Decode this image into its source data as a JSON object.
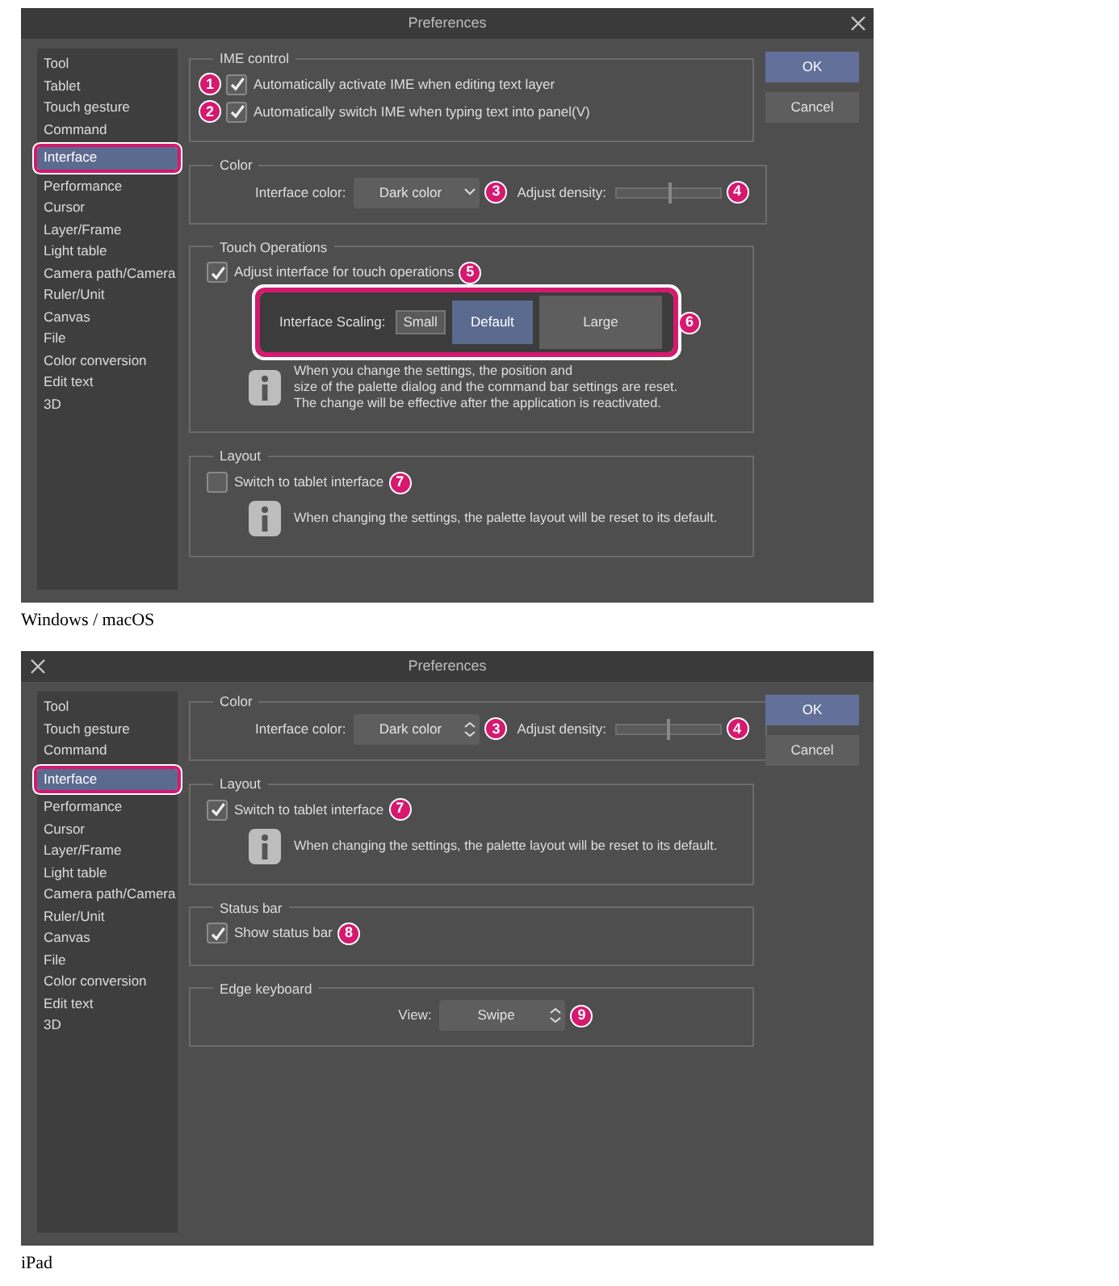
{
  "figures": [
    {
      "caption": "Windows / macOS",
      "dialog": {
        "title": "Preferences",
        "kind": "desktop",
        "sidebar": [
          {
            "label": "Tool",
            "selected": false
          },
          {
            "label": "Tablet",
            "selected": false
          },
          {
            "label": "Touch gesture",
            "selected": false
          },
          {
            "label": "Command",
            "selected": false
          },
          {
            "label": "Interface",
            "selected": true,
            "highlighted": true
          },
          {
            "label": "Performance",
            "selected": false
          },
          {
            "label": "Cursor",
            "selected": false
          },
          {
            "label": "Layer/Frame",
            "selected": false
          },
          {
            "label": "Light table",
            "selected": false
          },
          {
            "label": "Camera path/Camera",
            "selected": false
          },
          {
            "label": "Ruler/Unit",
            "selected": false
          },
          {
            "label": "Canvas",
            "selected": false
          },
          {
            "label": "File",
            "selected": false
          },
          {
            "label": "Color conversion",
            "selected": false
          },
          {
            "label": "Edit text",
            "selected": false
          },
          {
            "label": "3D",
            "selected": false
          }
        ],
        "sections": [
          {
            "title": "IME control",
            "rows": [
              {
                "items": [
                  {
                    "kind": "callout",
                    "text": "1"
                  },
                  {
                    "kind": "checkbox",
                    "label": "Automatically activate IME when editing text layer",
                    "checked": true
                  }
                ]
              },
              {
                "items": [
                  {
                    "kind": "callout",
                    "text": "2"
                  },
                  {
                    "kind": "checkbox",
                    "label": "Automatically switch IME when typing text into panel(V)",
                    "checked": true
                  }
                ]
              }
            ]
          },
          {
            "title": "Color",
            "rows": [
              {
                "items": [
                  {
                    "kind": "dropdown",
                    "label": "Interface color:",
                    "value": "Dark color"
                  },
                  {
                    "kind": "callout",
                    "text": "3"
                  },
                  {
                    "kind": "slider",
                    "label": "Adjust density:",
                    "level": 0.53
                  },
                  {
                    "kind": "callout",
                    "text": "4"
                  }
                ]
              }
            ]
          },
          {
            "title": "Touch Operations",
            "rows": [
              {
                "items": [
                  {
                    "kind": "checkbox",
                    "label": "Adjust interface for touch operations",
                    "checked": true
                  },
                  {
                    "kind": "callout",
                    "text": "5"
                  }
                ]
              },
              {
                "items": [
                  {
                    "kind": "segmented",
                    "label": "Interface Scaling:",
                    "highlighted": true,
                    "options": [
                      {
                        "label": "Small",
                        "selected": false
                      },
                      {
                        "label": "Default",
                        "selected": true
                      },
                      {
                        "label": "Large",
                        "selected": false
                      }
                    ]
                  },
                  {
                    "kind": "callout",
                    "text": "6"
                  }
                ]
              },
              {
                "items": [
                  {
                    "kind": "info",
                    "text": "When you change the settings, the position and\nsize of the palette dialog and the command bar settings are reset.\nThe change will be effective after the application is reactivated."
                  }
                ]
              }
            ]
          },
          {
            "title": "Layout",
            "rows": [
              {
                "items": [
                  {
                    "kind": "checkbox",
                    "label": "Switch to tablet interface",
                    "checked": false
                  },
                  {
                    "kind": "callout",
                    "text": "7"
                  }
                ]
              },
              {
                "items": [
                  {
                    "kind": "info",
                    "text": "When changing the settings, the palette layout will be reset to its default."
                  }
                ]
              }
            ]
          }
        ],
        "buttons": [
          {
            "label": "OK",
            "primary": true
          },
          {
            "label": "Cancel",
            "primary": false
          }
        ]
      }
    },
    {
      "caption": "iPad",
      "dialog": {
        "title": "Preferences",
        "kind": "tablet",
        "sidebar": [
          {
            "label": "Tool",
            "selected": false
          },
          {
            "label": "Touch gesture",
            "selected": false
          },
          {
            "label": "Command",
            "selected": false
          },
          {
            "label": "Interface",
            "selected": true,
            "highlighted": true
          },
          {
            "label": "Performance",
            "selected": false
          },
          {
            "label": "Cursor",
            "selected": false
          },
          {
            "label": "Layer/Frame",
            "selected": false
          },
          {
            "label": "Light table",
            "selected": false
          },
          {
            "label": "Camera path/Camera",
            "selected": false
          },
          {
            "label": "Ruler/Unit",
            "selected": false
          },
          {
            "label": "Canvas",
            "selected": false
          },
          {
            "label": "File",
            "selected": false
          },
          {
            "label": "Color conversion",
            "selected": false
          },
          {
            "label": "Edit text",
            "selected": false
          },
          {
            "label": "3D",
            "selected": false
          }
        ],
        "sections": [
          {
            "title": "Color",
            "rows": [
              {
                "items": [
                  {
                    "kind": "spinner",
                    "label": "Interface color:",
                    "value": "Dark color"
                  },
                  {
                    "kind": "callout",
                    "text": "3"
                  },
                  {
                    "kind": "slider",
                    "label": "Adjust density:",
                    "level": 0.5
                  },
                  {
                    "kind": "callout",
                    "text": "4"
                  }
                ]
              }
            ]
          },
          {
            "title": "Layout",
            "rows": [
              {
                "items": [
                  {
                    "kind": "checkbox",
                    "label": "Switch to tablet interface",
                    "checked": true
                  },
                  {
                    "kind": "callout",
                    "text": "7"
                  }
                ]
              },
              {
                "items": [
                  {
                    "kind": "info",
                    "text": "When changing the settings, the palette layout will be reset to its default."
                  }
                ]
              }
            ]
          },
          {
            "title": "Status bar",
            "rows": [
              {
                "items": [
                  {
                    "kind": "checkbox",
                    "label": "Show status bar",
                    "checked": true
                  },
                  {
                    "kind": "callout",
                    "text": "8"
                  }
                ]
              }
            ]
          },
          {
            "title": "Edge keyboard",
            "rows": [
              {
                "items": [
                  {
                    "kind": "spinner",
                    "label": "View:",
                    "value": "Swipe"
                  },
                  {
                    "kind": "callout",
                    "text": "9"
                  }
                ]
              }
            ]
          }
        ],
        "buttons": [
          {
            "label": "OK",
            "primary": true
          },
          {
            "label": "Cancel",
            "primary": false
          }
        ]
      }
    }
  ]
}
